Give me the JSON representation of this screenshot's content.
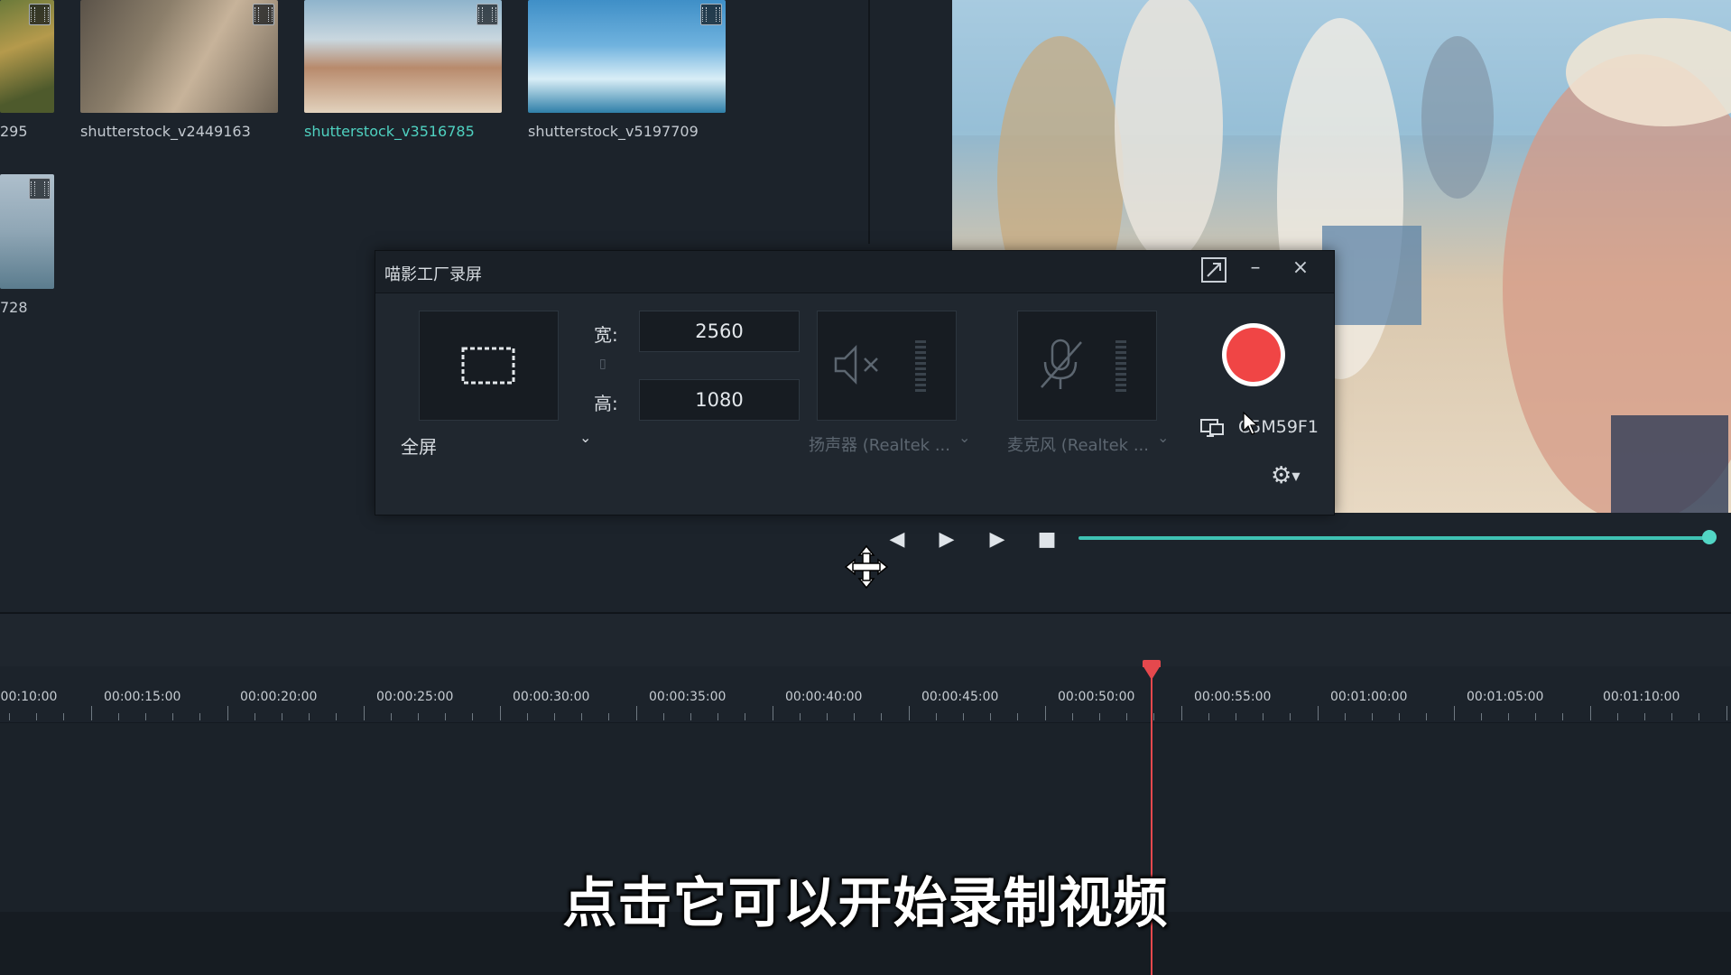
{
  "library": {
    "items": [
      {
        "caption": "295",
        "selected": false
      },
      {
        "caption": "shutterstock_v2449163",
        "selected": false
      },
      {
        "caption": "shutterstock_v3516785",
        "selected": true
      },
      {
        "caption": "shutterstock_v5197709",
        "selected": false
      },
      {
        "caption": "728",
        "selected": false
      }
    ]
  },
  "recorder": {
    "title": "喵影工厂录屏",
    "region_mode": "全屏",
    "width_label": "宽:",
    "width_value": "2560",
    "height_label": "高:",
    "height_value": "1080",
    "speaker_label": "扬声器 (Realtek ...",
    "mic_label": "麦克风 (Realtek ...",
    "display_label": "C5M59F1",
    "record_color": "#f04545"
  },
  "timeline": {
    "ticks": [
      "00:00:10:00",
      "00:00:15:00",
      "00:00:20:00",
      "00:00:25:00",
      "00:00:30:00",
      "00:00:35:00",
      "00:00:40:00",
      "00:00:45:00",
      "00:00:50:00",
      "00:00:55:00",
      "00:01:00:00",
      "00:01:05:00",
      "00:01:10:00"
    ],
    "playhead_color": "#e5484d"
  },
  "transport": {
    "accent": "#3fc2b3"
  },
  "subtitle": "点击它可以开始录制视频"
}
